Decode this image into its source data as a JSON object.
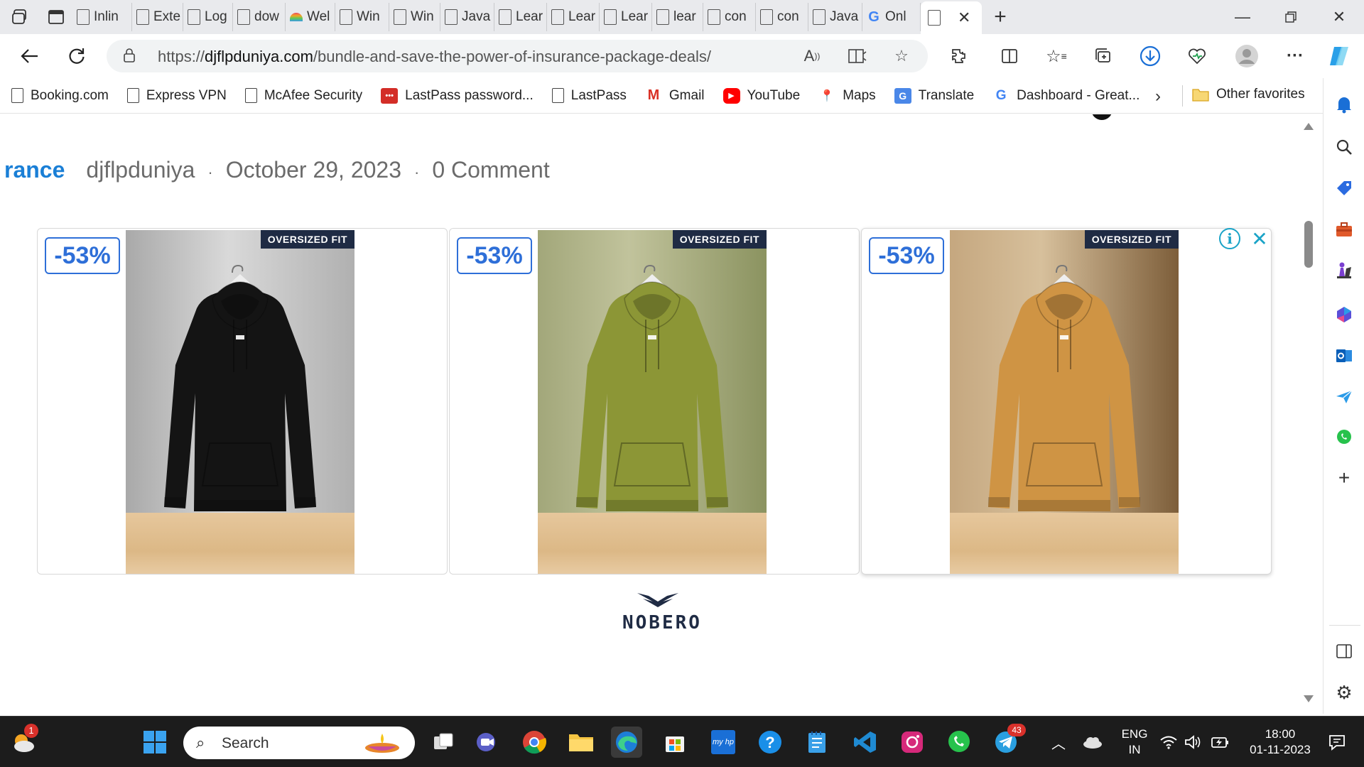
{
  "tabs": [
    {
      "label": "Inlin",
      "icon": "page-icon"
    },
    {
      "label": "Exte",
      "icon": "page-icon"
    },
    {
      "label": "Log",
      "icon": "page-icon"
    },
    {
      "label": "dow",
      "icon": "page-icon"
    },
    {
      "label": "Wel",
      "icon": "rainbow-icon"
    },
    {
      "label": "Win",
      "icon": "page-icon"
    },
    {
      "label": "Win",
      "icon": "page-icon"
    },
    {
      "label": "Java",
      "icon": "page-icon"
    },
    {
      "label": "Lear",
      "icon": "page-icon"
    },
    {
      "label": "Lear",
      "icon": "page-icon"
    },
    {
      "label": "Lear",
      "icon": "page-icon"
    },
    {
      "label": "lear",
      "icon": "page-icon"
    },
    {
      "label": "con",
      "icon": "page-icon"
    },
    {
      "label": "con",
      "icon": "page-icon"
    },
    {
      "label": "Java",
      "icon": "page-icon"
    },
    {
      "label": "Onl",
      "icon": "google-icon"
    }
  ],
  "address": {
    "scheme": "https://",
    "domain": "djflpduniya.com",
    "path": "/bundle-and-save-the-power-of-insurance-package-deals/"
  },
  "favorites": [
    {
      "label": "Booking.com",
      "icon": "page-icon"
    },
    {
      "label": "Express VPN",
      "icon": "page-icon"
    },
    {
      "label": "McAfee Security",
      "icon": "page-icon"
    },
    {
      "label": "LastPass password...",
      "icon": "lastpass-icon"
    },
    {
      "label": "LastPass",
      "icon": "page-icon"
    },
    {
      "label": "Gmail",
      "icon": "gmail-icon"
    },
    {
      "label": "YouTube",
      "icon": "youtube-icon"
    },
    {
      "label": "Maps",
      "icon": "maps-icon"
    },
    {
      "label": "Translate",
      "icon": "translate-icon"
    },
    {
      "label": "Dashboard - Great...",
      "icon": "g-icon"
    }
  ],
  "other_favorites": "Other favorites",
  "post_meta": {
    "category": "rance",
    "author": "djflpduniya",
    "date": "October 29, 2023",
    "comments": "0 Comment",
    "separator": "·"
  },
  "ad": {
    "cards": [
      {
        "discount": "-53%",
        "tag": "OVERSIZED FIT",
        "color": "black",
        "hoodie_hex": "#141414",
        "wall_hex": "#bdbdbd"
      },
      {
        "discount": "-53%",
        "tag": "OVERSIZED FIT",
        "color": "olive",
        "hoodie_hex": "#8c9636",
        "wall_hex": "#86905a"
      },
      {
        "discount": "-53%",
        "tag": "OVERSIZED FIT",
        "color": "mustard",
        "hoodie_hex": "#cf9444",
        "wall_hex": "#b08a57"
      }
    ],
    "brand": "NOBERO"
  },
  "taskbar": {
    "search_placeholder": "Search",
    "weather_badge": "1",
    "telegram_badge": "43",
    "lang_top": "ENG",
    "lang_bottom": "IN",
    "time": "18:00",
    "date": "01-11-2023"
  },
  "colors": {
    "accent": "#1a7fd6",
    "badge": "#2e6fd8",
    "tag_bg": "#1f2b44"
  }
}
